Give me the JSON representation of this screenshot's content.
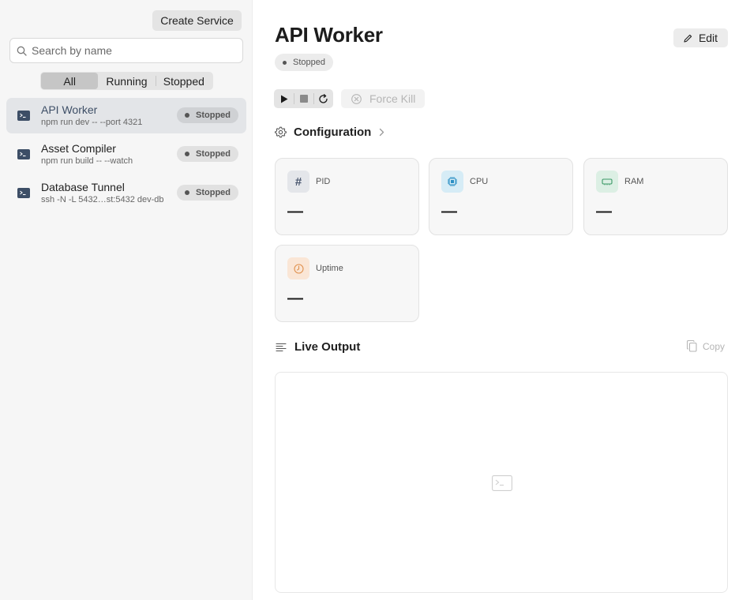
{
  "sidebar": {
    "create_button": "Create Service",
    "search": {
      "placeholder": "Search by name",
      "value": ""
    },
    "filters": [
      {
        "label": "All",
        "active": true
      },
      {
        "label": "Running",
        "active": false
      },
      {
        "label": "Stopped",
        "active": false
      }
    ],
    "services": [
      {
        "name": "API Worker",
        "command": "npm run dev -- --port 4321",
        "status": "Stopped",
        "selected": true,
        "icon": "terminal-icon"
      },
      {
        "name": "Asset Compiler",
        "command": "npm run build -- --watch",
        "status": "Stopped",
        "selected": false,
        "icon": "terminal-icon"
      },
      {
        "name": "Database Tunnel",
        "command": "ssh -N -L 5432…st:5432 dev-db",
        "status": "Stopped",
        "selected": false,
        "icon": "terminal-icon"
      }
    ]
  },
  "main": {
    "title": "API Worker",
    "edit_button": "Edit",
    "status": "Stopped",
    "controls": {
      "play_icon": "play-icon",
      "stop_icon": "stop-icon",
      "restart_icon": "restart-icon",
      "force_kill": "Force Kill"
    },
    "configuration_label": "Configuration",
    "stats": [
      {
        "label": "PID",
        "value": "—",
        "icon": "hash-icon",
        "color": "#e4e6ea"
      },
      {
        "label": "CPU",
        "value": "—",
        "icon": "cpu-icon",
        "color": "#d6ecf6"
      },
      {
        "label": "RAM",
        "value": "—",
        "icon": "memory-icon",
        "color": "#dcefe4"
      },
      {
        "label": "Uptime",
        "value": "—",
        "icon": "clock-icon",
        "color": "#fae6d6"
      }
    ],
    "live_output_label": "Live Output",
    "copy_button": "Copy"
  }
}
